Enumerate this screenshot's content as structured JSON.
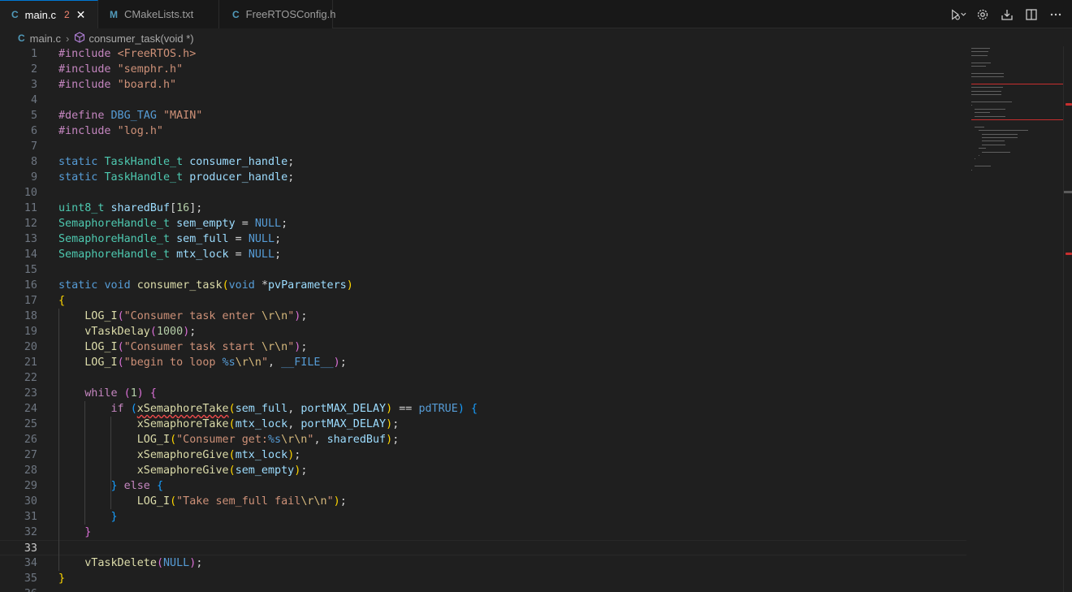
{
  "tabs": [
    {
      "icon": "C",
      "label": "main.c",
      "badge": "2",
      "active": true
    },
    {
      "icon": "M",
      "label": "CMakeLists.txt"
    },
    {
      "icon": "C",
      "label": "FreeRTOSConfig.h"
    }
  ],
  "breadcrumb": {
    "file": "main.c",
    "symbol": "consumer_task(void *)"
  },
  "editor": {
    "current_line": 33,
    "lines": [
      [
        [
          "t-pp",
          "#include "
        ],
        [
          "t-str",
          "<FreeRTOS.h>"
        ]
      ],
      [
        [
          "t-pp",
          "#include "
        ],
        [
          "t-str",
          "\"semphr.h\""
        ]
      ],
      [
        [
          "t-pp",
          "#include "
        ],
        [
          "t-str",
          "\"board.h\""
        ]
      ],
      [],
      [
        [
          "t-pp",
          "#define "
        ],
        [
          "t-macro",
          "DBG_TAG "
        ],
        [
          "t-str",
          "\"MAIN\""
        ]
      ],
      [
        [
          "t-pp",
          "#include "
        ],
        [
          "t-str",
          "\"log.h\""
        ]
      ],
      [],
      [
        [
          "t-kw",
          "static "
        ],
        [
          "t-type",
          "TaskHandle_t "
        ],
        [
          "t-var",
          "consumer_handle"
        ],
        [
          "t-p",
          ";"
        ]
      ],
      [
        [
          "t-kw",
          "static "
        ],
        [
          "t-type",
          "TaskHandle_t "
        ],
        [
          "t-var",
          "producer_handle"
        ],
        [
          "t-p",
          ";"
        ]
      ],
      [],
      [
        [
          "t-type",
          "uint8_t "
        ],
        [
          "t-var",
          "sharedBuf"
        ],
        [
          "t-p",
          "["
        ],
        [
          "t-num",
          "16"
        ],
        [
          "t-p",
          "];"
        ]
      ],
      [
        [
          "t-type",
          "SemaphoreHandle_t "
        ],
        [
          "t-var",
          "sem_empty"
        ],
        [
          "t-p",
          " = "
        ],
        [
          "t-kw",
          "NULL"
        ],
        [
          "t-p",
          ";"
        ]
      ],
      [
        [
          "t-type",
          "SemaphoreHandle_t "
        ],
        [
          "t-var",
          "sem_full"
        ],
        [
          "t-p",
          " = "
        ],
        [
          "t-kw",
          "NULL"
        ],
        [
          "t-p",
          ";"
        ]
      ],
      [
        [
          "t-type",
          "SemaphoreHandle_t "
        ],
        [
          "t-var",
          "mtx_lock"
        ],
        [
          "t-p",
          " = "
        ],
        [
          "t-kw",
          "NULL"
        ],
        [
          "t-p",
          ";"
        ]
      ],
      [],
      [
        [
          "t-kw",
          "static "
        ],
        [
          "t-kw",
          "void "
        ],
        [
          "t-fn",
          "consumer_task"
        ],
        [
          "b1",
          "("
        ],
        [
          "t-kw",
          "void "
        ],
        [
          "t-p",
          "*"
        ],
        [
          "t-var",
          "pvParameters"
        ],
        [
          "b1",
          ")"
        ]
      ],
      [
        [
          "b1",
          "{"
        ]
      ],
      [
        [
          "t-p",
          "    "
        ],
        [
          "t-fn",
          "LOG_I"
        ],
        [
          "b2",
          "("
        ],
        [
          "t-str",
          "\"Consumer task enter "
        ],
        [
          "t-esc",
          "\\r\\n"
        ],
        [
          "t-str",
          "\""
        ],
        [
          "b2",
          ")"
        ],
        [
          "t-p",
          ";"
        ]
      ],
      [
        [
          "t-p",
          "    "
        ],
        [
          "t-fn",
          "vTaskDelay"
        ],
        [
          "b2",
          "("
        ],
        [
          "t-num",
          "1000"
        ],
        [
          "b2",
          ")"
        ],
        [
          "t-p",
          ";"
        ]
      ],
      [
        [
          "t-p",
          "    "
        ],
        [
          "t-fn",
          "LOG_I"
        ],
        [
          "b2",
          "("
        ],
        [
          "t-str",
          "\"Consumer task start "
        ],
        [
          "t-esc",
          "\\r\\n"
        ],
        [
          "t-str",
          "\""
        ],
        [
          "b2",
          ")"
        ],
        [
          "t-p",
          ";"
        ]
      ],
      [
        [
          "t-p",
          "    "
        ],
        [
          "t-fn",
          "LOG_I"
        ],
        [
          "b2",
          "("
        ],
        [
          "t-str",
          "\"begin to loop "
        ],
        [
          "t-kw",
          "%s"
        ],
        [
          "t-esc",
          "\\r\\n"
        ],
        [
          "t-str",
          "\""
        ],
        [
          "t-p",
          ", "
        ],
        [
          "t-macro",
          "__FILE__"
        ],
        [
          "b2",
          ")"
        ],
        [
          "t-p",
          ";"
        ]
      ],
      [],
      [
        [
          "t-p",
          "    "
        ],
        [
          "t-ctl",
          "while "
        ],
        [
          "b2",
          "("
        ],
        [
          "t-num",
          "1"
        ],
        [
          "b2",
          ")"
        ],
        [
          "t-p",
          " "
        ],
        [
          "b2",
          "{"
        ]
      ],
      [
        [
          "t-p",
          "        "
        ],
        [
          "t-ctl",
          "if "
        ],
        [
          "b3",
          "("
        ],
        [
          "t-fn squig",
          "xSemaphoreTake"
        ],
        [
          "b1",
          "("
        ],
        [
          "t-var",
          "sem_full"
        ],
        [
          "t-p",
          ", "
        ],
        [
          "t-var",
          "portMAX_DELAY"
        ],
        [
          "b1",
          ")"
        ],
        [
          "t-p",
          " == "
        ],
        [
          "t-kw",
          "pdTRUE"
        ],
        [
          "b3",
          ")"
        ],
        [
          "t-p",
          " "
        ],
        [
          "b3",
          "{"
        ]
      ],
      [
        [
          "t-p",
          "            "
        ],
        [
          "t-fn",
          "xSemaphoreTake"
        ],
        [
          "b1",
          "("
        ],
        [
          "t-var",
          "mtx_lock"
        ],
        [
          "t-p",
          ", "
        ],
        [
          "t-var",
          "portMAX_DELAY"
        ],
        [
          "b1",
          ")"
        ],
        [
          "t-p",
          ";"
        ]
      ],
      [
        [
          "t-p",
          "            "
        ],
        [
          "t-fn",
          "LOG_I"
        ],
        [
          "b1",
          "("
        ],
        [
          "t-str",
          "\"Consumer get:"
        ],
        [
          "t-kw",
          "%s"
        ],
        [
          "t-esc",
          "\\r\\n"
        ],
        [
          "t-str",
          "\""
        ],
        [
          "t-p",
          ", "
        ],
        [
          "t-var",
          "sharedBuf"
        ],
        [
          "b1",
          ")"
        ],
        [
          "t-p",
          ";"
        ]
      ],
      [
        [
          "t-p",
          "            "
        ],
        [
          "t-fn",
          "xSemaphoreGive"
        ],
        [
          "b1",
          "("
        ],
        [
          "t-var",
          "mtx_lock"
        ],
        [
          "b1",
          ")"
        ],
        [
          "t-p",
          ";"
        ]
      ],
      [
        [
          "t-p",
          "            "
        ],
        [
          "t-fn",
          "xSemaphoreGive"
        ],
        [
          "b1",
          "("
        ],
        [
          "t-var",
          "sem_empty"
        ],
        [
          "b1",
          ")"
        ],
        [
          "t-p",
          ";"
        ]
      ],
      [
        [
          "t-p",
          "        "
        ],
        [
          "b3",
          "}"
        ],
        [
          "t-p",
          " "
        ],
        [
          "t-ctl",
          "else "
        ],
        [
          "b3",
          "{"
        ]
      ],
      [
        [
          "t-p",
          "            "
        ],
        [
          "t-fn",
          "LOG_I"
        ],
        [
          "b1",
          "("
        ],
        [
          "t-str",
          "\"Take sem_full fail"
        ],
        [
          "t-esc",
          "\\r\\n"
        ],
        [
          "t-str",
          "\""
        ],
        [
          "b1",
          ")"
        ],
        [
          "t-p",
          ";"
        ]
      ],
      [
        [
          "t-p",
          "        "
        ],
        [
          "b3",
          "}"
        ]
      ],
      [
        [
          "t-p",
          "    "
        ],
        [
          "b2",
          "}"
        ]
      ],
      [],
      [
        [
          "t-p",
          "    "
        ],
        [
          "t-fn",
          "vTaskDelete"
        ],
        [
          "b2",
          "("
        ],
        [
          "t-kw",
          "NULL"
        ],
        [
          "b2",
          ")"
        ],
        [
          "t-p",
          ";"
        ]
      ],
      [
        [
          "b1",
          "}"
        ]
      ],
      []
    ]
  }
}
